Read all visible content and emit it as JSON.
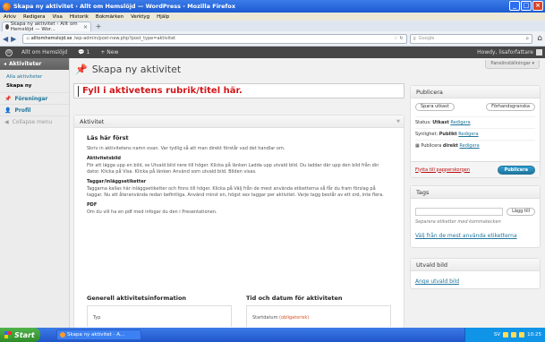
{
  "window": {
    "title": "Skapa ny aktivitet ‹ Allt om Hemslöjd — WordPress - Mozilla Firefox"
  },
  "menubar": [
    "Arkiv",
    "Redigera",
    "Visa",
    "Historik",
    "Bokmärken",
    "Verktyg",
    "Hjälp"
  ],
  "tab": {
    "label": "Skapa ny aktivitet ‹ Allt om Hemslöjd — Wor..."
  },
  "nav": {
    "url_domain": "alltomhemslojd.se",
    "url_path": "/wp-admin/post-new.php?post_type=aktivitet",
    "search_placeholder": "Google"
  },
  "adminbar": {
    "site": "Allt om Hemslöjd",
    "comments": "1",
    "new": "+ New",
    "howdy": "Howdy, lisaforfattare"
  },
  "sidebar": {
    "active": "Aktiviteter",
    "sub": [
      "Alla aktiviteter",
      "Skapa ny"
    ],
    "items": [
      "Föreningar",
      "Profil",
      "Collapse menu"
    ]
  },
  "page": {
    "title": "Skapa ny aktivitet",
    "screen_options": "Panelinställningar ▾",
    "title_input": "Fyll i aktivetens rubrik/titel här."
  },
  "main": {
    "header": "Aktivitet",
    "h3": "Läs här först",
    "intro": "Skriv in aktivitetens namn ovan. Var tydlig så att man direkt förstår vad det handlar om.",
    "img_h": "Aktivitetsbild",
    "img_p": "För att lägga upp en bild, se Utvald bild nere till höger. Klicka på länken Ladda upp utvald bild. Du laddar där upp den bild från din dator. Klicka på Visa. Klicka på länken Använd som utvald bild. Bilden visas.",
    "tags_h": "Taggar/inläggsetiketter",
    "tags_p": "Taggarna kallas här inläggsetiketter och finns till höger. Klicka på Välj från de mest använda etiketterna så får du fram förslag på taggar. Nu att återanvända redan befintliga. Använd minst en, högst sex taggar per aktivitet. Varje tagg består av ett ord, inte flera.",
    "pdf_h": "PDF",
    "pdf_p": "Om du vill ha en pdf med infogar du den i Presentationen.",
    "sec1": "Generell aktivitetsinformation",
    "sec1_inner": "Typ",
    "sec2": "Tid och datum för aktiviteten",
    "sec2_inner": "Startdatum",
    "sec2_req": "(obligatorisk)"
  },
  "publish": {
    "header": "Publicera",
    "save_draft": "Spara utkast",
    "preview": "Förhandsgranska",
    "status_label": "Status:",
    "status_value": "Utkast",
    "visibility_label": "Synlighet:",
    "visibility_value": "Publikt",
    "publish_label": "Publicera",
    "publish_value": "direkt",
    "edit": "Redigera",
    "trash": "Flytta till papperskorgen",
    "publish_btn": "Publicera"
  },
  "tags": {
    "header": "Tags",
    "add": "Lägg till",
    "hint": "Separera etiketter med kommatecken",
    "choose": "Välj från de mest använda etiketterna"
  },
  "featured": {
    "header": "Utvald bild",
    "link": "Ange utvald bild"
  },
  "taskbar": {
    "start": "Start",
    "task": "Skapa ny aktivitet - A...",
    "clock": "10:25",
    "tray_lang": "SV"
  }
}
